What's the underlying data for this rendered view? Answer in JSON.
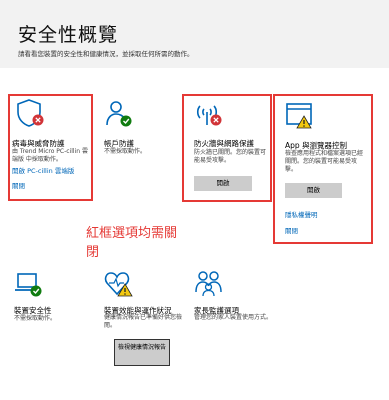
{
  "header": {
    "title": "安全性概覽",
    "subtitle": "請看看您裝置的安全性和健康情況，並採取任何所需的動作。"
  },
  "tiles": {
    "virus": {
      "title": "病毒與威脅防護",
      "desc": "由 Trend Micro PC-cillin 雲端版 中採取動作。",
      "link1": "開啟 PC-cillin 雲端版",
      "link2": "關閉"
    },
    "account": {
      "title": "帳戶防護",
      "desc": "不需採取動作。"
    },
    "firewall": {
      "title": "防火牆與網路保護",
      "desc": "防火牆已關閉。您的裝置可能易受攻擊。",
      "button": "開啟"
    },
    "appbrowser": {
      "title": "App 與瀏覽器控制",
      "desc": "檢查應用程式和檔案選項已經關閉。您的裝置可能易受攻擊。",
      "button": "開啟",
      "link1": "隱私權聲明",
      "link2": "關閉"
    },
    "device": {
      "title": "裝置安全性",
      "desc": "不需採取動作。"
    },
    "performance": {
      "title": "裝置效能與運作狀況",
      "desc": "健康情況報告已準備好供您檢閱。",
      "button": "檢視健康情況報告"
    },
    "family": {
      "title": "家長監護選項",
      "desc": "管理您的家人裝置使用方式。"
    }
  },
  "annotation": "紅框選項均需關閉",
  "colors": {
    "accent": "#0067b8",
    "warning_red": "#d13438",
    "ok_green": "#107c10",
    "warning_yellow": "#f2c811",
    "annotation_red": "#e53935"
  }
}
